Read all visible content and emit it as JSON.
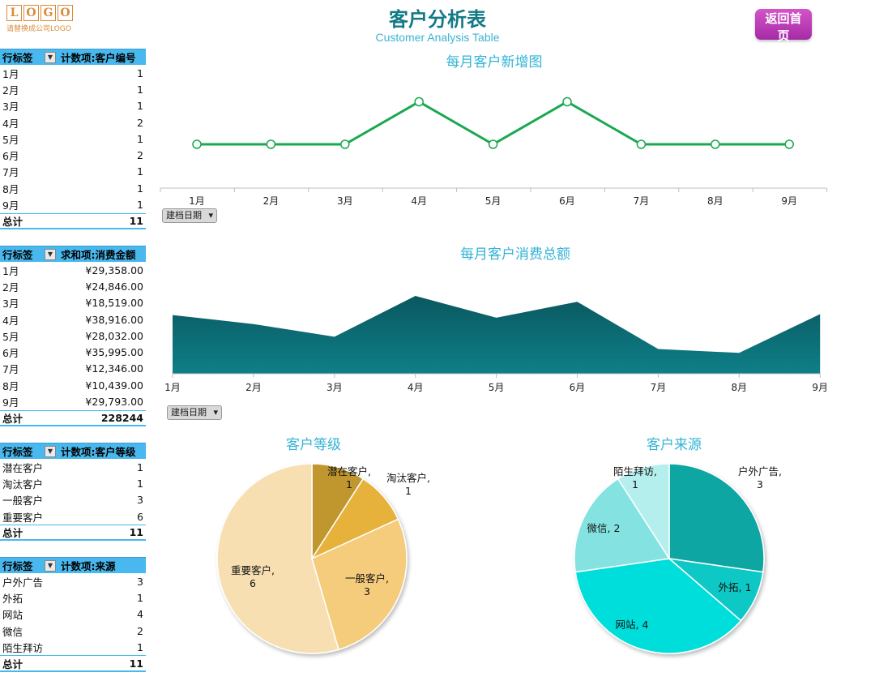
{
  "logo": {
    "letters": [
      "L",
      "O",
      "G",
      "O"
    ],
    "sub": "请替换成公司LOGO"
  },
  "title": "客户分析表",
  "subtitle": "Customer Analysis Table",
  "home_button": "返回首页",
  "colors": {
    "line": "#1aa850",
    "area": "#0d6f78",
    "accent": "#49b8ee",
    "grade": [
      "#c0962e",
      "#e6b23a",
      "#f5cb7c",
      "#f7dfb2"
    ],
    "source": [
      "#0aa6a2",
      "#11c8c4",
      "#04dedb",
      "#84e3e0",
      "#b4efee"
    ]
  },
  "pivots": [
    {
      "h1": "行标签",
      "h2": "计数项:客户编号",
      "rows": [
        [
          "1月",
          "1"
        ],
        [
          "2月",
          "1"
        ],
        [
          "3月",
          "1"
        ],
        [
          "4月",
          "2"
        ],
        [
          "5月",
          "1"
        ],
        [
          "6月",
          "2"
        ],
        [
          "7月",
          "1"
        ],
        [
          "8月",
          "1"
        ],
        [
          "9月",
          "1"
        ]
      ],
      "total": [
        "总计",
        "11"
      ]
    },
    {
      "h1": "行标签",
      "h2": "求和项:消费金额",
      "rows": [
        [
          "1月",
          "¥29,358.00"
        ],
        [
          "2月",
          "¥24,846.00"
        ],
        [
          "3月",
          "¥18,519.00"
        ],
        [
          "4月",
          "¥38,916.00"
        ],
        [
          "5月",
          "¥28,032.00"
        ],
        [
          "6月",
          "¥35,995.00"
        ],
        [
          "7月",
          "¥12,346.00"
        ],
        [
          "8月",
          "¥10,439.00"
        ],
        [
          "9月",
          "¥29,793.00"
        ]
      ],
      "total": [
        "总计",
        "228244"
      ]
    },
    {
      "h1": "行标签",
      "h2": "计数项:客户等级",
      "rows": [
        [
          "潜在客户",
          "1"
        ],
        [
          "淘汰客户",
          "1"
        ],
        [
          "一般客户",
          "3"
        ],
        [
          "重要客户",
          "6"
        ]
      ],
      "total": [
        "总计",
        "11"
      ]
    },
    {
      "h1": "行标签",
      "h2": "计数项:来源",
      "rows": [
        [
          "户外广告",
          "3"
        ],
        [
          "外拓",
          "1"
        ],
        [
          "网站",
          "4"
        ],
        [
          "微信",
          "2"
        ],
        [
          "陌生拜访",
          "1"
        ]
      ],
      "total": [
        "总计",
        "11"
      ]
    }
  ],
  "filter_label": "建档日期",
  "chart_data": [
    {
      "type": "line",
      "title": "每月客户新增图",
      "categories": [
        "1月",
        "2月",
        "3月",
        "4月",
        "5月",
        "6月",
        "7月",
        "8月",
        "9月"
      ],
      "values": [
        1,
        1,
        1,
        2,
        1,
        2,
        1,
        1,
        1
      ]
    },
    {
      "type": "area",
      "title": "每月客户消费总额",
      "categories": [
        "1月",
        "2月",
        "3月",
        "4月",
        "5月",
        "6月",
        "7月",
        "8月",
        "9月"
      ],
      "values": [
        29358,
        24846,
        18519,
        38916,
        28032,
        35995,
        12346,
        10439,
        29793
      ]
    },
    {
      "type": "pie",
      "title": "客户等级",
      "labels": [
        "潜在客户",
        "淘汰客户",
        "一般客户",
        "重要客户"
      ],
      "values": [
        1,
        1,
        3,
        6
      ]
    },
    {
      "type": "pie",
      "title": "客户来源",
      "labels": [
        "户外广告",
        "外拓",
        "网站",
        "微信",
        "陌生拜访"
      ],
      "values": [
        3,
        1,
        4,
        2,
        1
      ]
    }
  ]
}
